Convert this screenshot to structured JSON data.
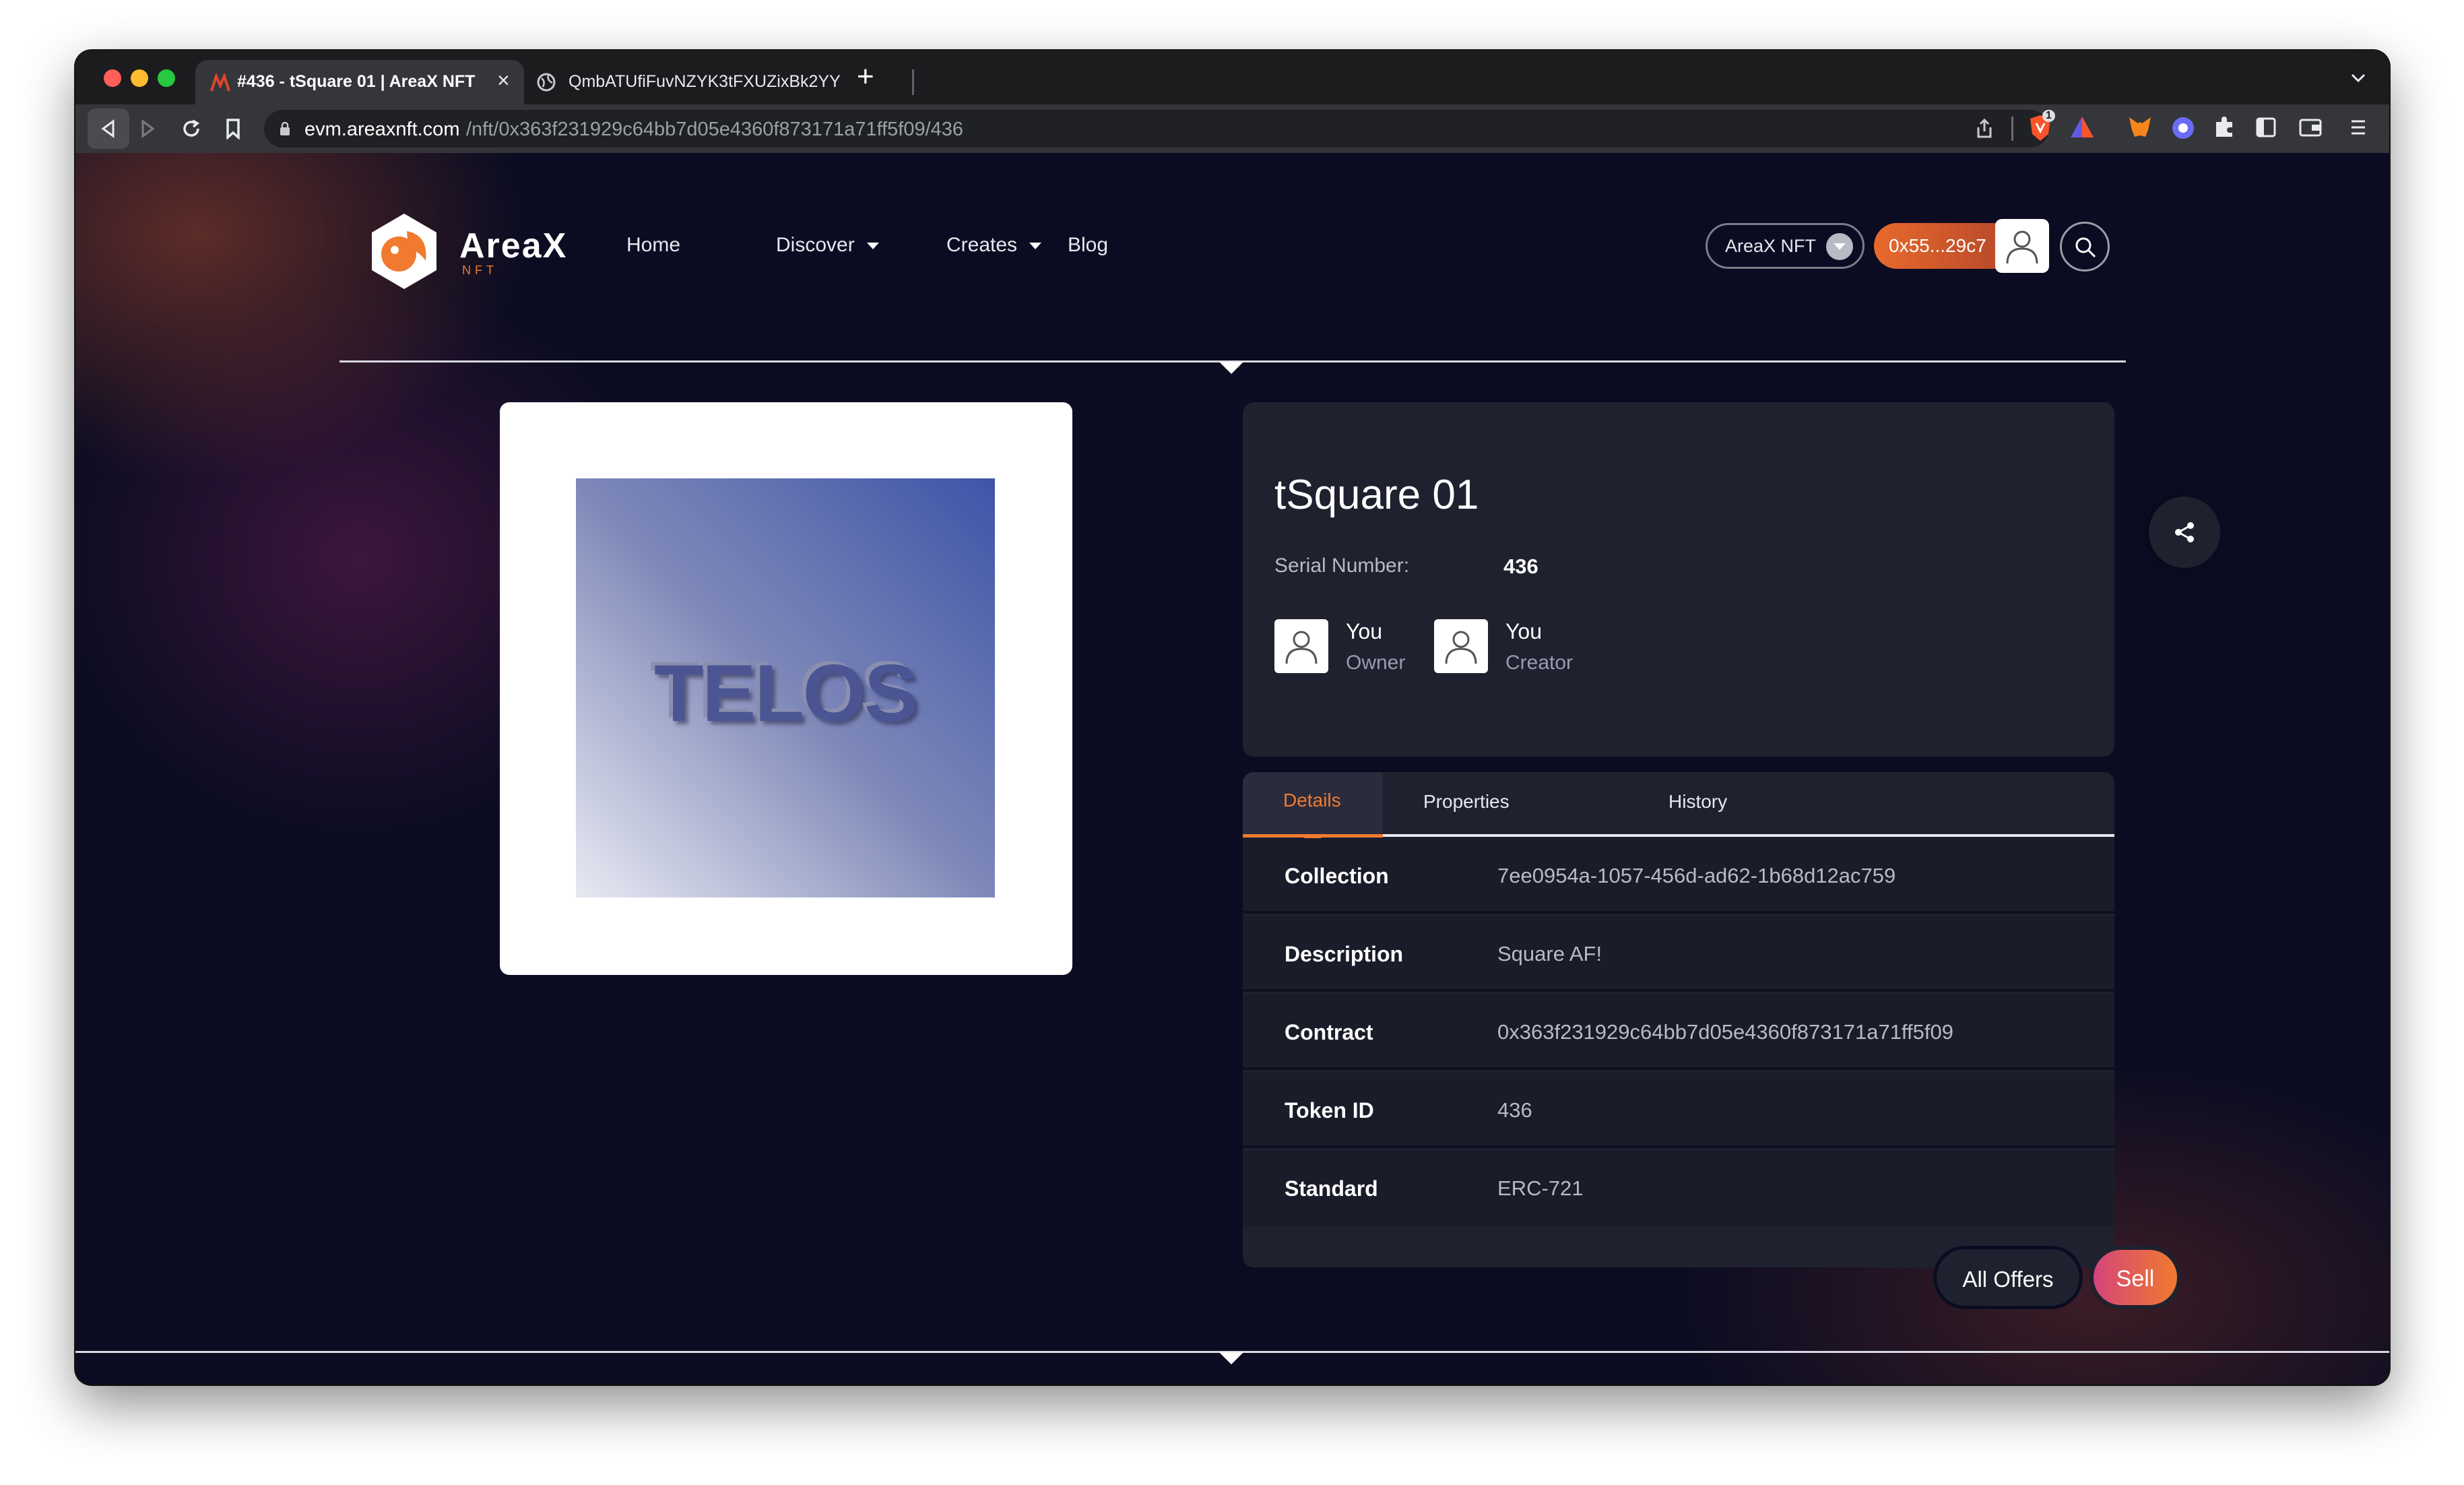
{
  "browser": {
    "tabs": [
      {
        "title": "#436 - tSquare 01 | AreaX NFT",
        "active": true
      },
      {
        "title": "QmbATUfiFuvNZYK3tFXUZixBk2YY",
        "active": false
      }
    ],
    "url_domain": "evm.areaxnft.com",
    "url_path": "/nft/0x363f231929c64bb7d05e4360f873171a71ff5f09/436",
    "shield_badge": "1"
  },
  "header": {
    "logo_text": "AreaX",
    "logo_sub": "NFT",
    "nav": {
      "home": "Home",
      "discover": "Discover",
      "creates": "Creates",
      "blog": "Blog"
    },
    "network_label": "AreaX NFT",
    "wallet_label": "0x55...29c7"
  },
  "artwork": {
    "text": "TELOS"
  },
  "nft": {
    "title": "tSquare 01",
    "serial_label": "Serial Number:",
    "serial_value": "436",
    "owner": {
      "name": "You",
      "role": "Owner"
    },
    "creator": {
      "name": "You",
      "role": "Creator"
    }
  },
  "tabs": {
    "details": "Details",
    "properties": "Properties",
    "history": "History"
  },
  "details": [
    {
      "key": "Collection",
      "value": "7ee0954a-1057-456d-ad62-1b68d12ac759"
    },
    {
      "key": "Description",
      "value": "Square AF!"
    },
    {
      "key": "Contract",
      "value": "0x363f231929c64bb7d05e4360f873171a71ff5f09"
    },
    {
      "key": "Token ID",
      "value": "436"
    },
    {
      "key": "Standard",
      "value": "ERC-721"
    }
  ],
  "actions": {
    "all_offers": "All Offers",
    "sell": "Sell"
  },
  "colors": {
    "accent": "#f07a2e",
    "background": "#0b0c22",
    "card": "#1f212f"
  }
}
